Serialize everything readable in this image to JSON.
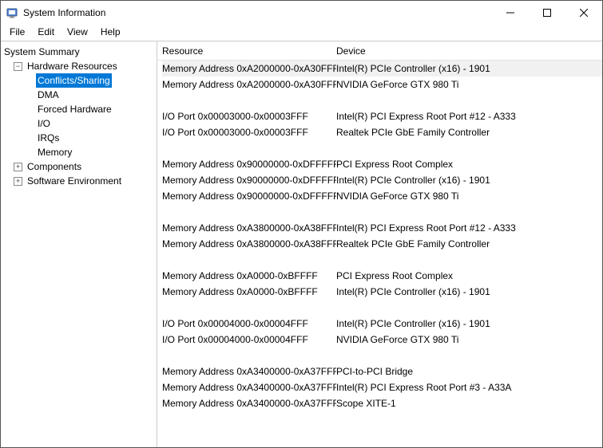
{
  "window": {
    "title": "System Information",
    "icon": "sysinfo-icon"
  },
  "menu": {
    "file": "File",
    "edit": "Edit",
    "view": "View",
    "help": "Help"
  },
  "tree": {
    "root": "System Summary",
    "hwres": {
      "label": "Hardware Resources",
      "children": {
        "conflicts": "Conflicts/Sharing",
        "dma": "DMA",
        "forced": "Forced Hardware",
        "io": "I/O",
        "irqs": "IRQs",
        "memory": "Memory"
      }
    },
    "components": "Components",
    "softenv": "Software Environment"
  },
  "list": {
    "columns": {
      "resource": "Resource",
      "device": "Device"
    },
    "rows": [
      {
        "resource": "Memory Address 0xA2000000-0xA30FFF...",
        "device": "Intel(R) PCIe Controller (x16) - 1901",
        "selected": true
      },
      {
        "resource": "Memory Address 0xA2000000-0xA30FFF...",
        "device": "NVIDIA GeForce GTX 980 Ti"
      },
      {
        "blank": true
      },
      {
        "resource": "I/O Port 0x00003000-0x00003FFF",
        "device": "Intel(R) PCI Express Root Port #12 - A333"
      },
      {
        "resource": "I/O Port 0x00003000-0x00003FFF",
        "device": "Realtek PCIe GbE Family Controller"
      },
      {
        "blank": true
      },
      {
        "resource": "Memory Address 0x90000000-0xDFFFFF...",
        "device": "PCI Express Root Complex"
      },
      {
        "resource": "Memory Address 0x90000000-0xDFFFFF...",
        "device": "Intel(R) PCIe Controller (x16) - 1901"
      },
      {
        "resource": "Memory Address 0x90000000-0xDFFFFF...",
        "device": "NVIDIA GeForce GTX 980 Ti"
      },
      {
        "blank": true
      },
      {
        "resource": "Memory Address 0xA3800000-0xA38FFF...",
        "device": "Intel(R) PCI Express Root Port #12 - A333"
      },
      {
        "resource": "Memory Address 0xA3800000-0xA38FFF...",
        "device": "Realtek PCIe GbE Family Controller"
      },
      {
        "blank": true
      },
      {
        "resource": "Memory Address 0xA0000-0xBFFFF",
        "device": "PCI Express Root Complex"
      },
      {
        "resource": "Memory Address 0xA0000-0xBFFFF",
        "device": "Intel(R) PCIe Controller (x16) - 1901"
      },
      {
        "blank": true
      },
      {
        "resource": "I/O Port 0x00004000-0x00004FFF",
        "device": "Intel(R) PCIe Controller (x16) - 1901"
      },
      {
        "resource": "I/O Port 0x00004000-0x00004FFF",
        "device": "NVIDIA GeForce GTX 980 Ti"
      },
      {
        "blank": true
      },
      {
        "resource": "Memory Address 0xA3400000-0xA37FFF...",
        "device": "PCI-to-PCI Bridge"
      },
      {
        "resource": "Memory Address 0xA3400000-0xA37FFF...",
        "device": "Intel(R) PCI Express Root Port #3 - A33A"
      },
      {
        "resource": "Memory Address 0xA3400000-0xA37FFF...",
        "device": "Scope XITE-1"
      }
    ]
  }
}
